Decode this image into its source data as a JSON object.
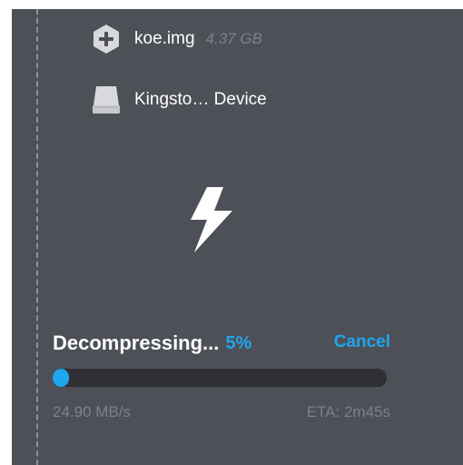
{
  "source": {
    "icon": "plus-hexagon-icon",
    "name": "koe.img",
    "size": "4.37 GB"
  },
  "drive": {
    "icon": "drive-icon",
    "name": "Kingsto… Device"
  },
  "flash": {
    "icon": "lightning-bolt-icon"
  },
  "progress": {
    "status_label": "Decompressing...",
    "percent_label": "5%",
    "percent_value": 0.05,
    "cancel_label": "Cancel",
    "speed": "24.90 MB/s",
    "eta": "ETA: 2m45s"
  },
  "colors": {
    "background": "#4d5057",
    "accent": "#1ea6f0",
    "track": "#2e3035",
    "muted_text": "#7d8088"
  }
}
